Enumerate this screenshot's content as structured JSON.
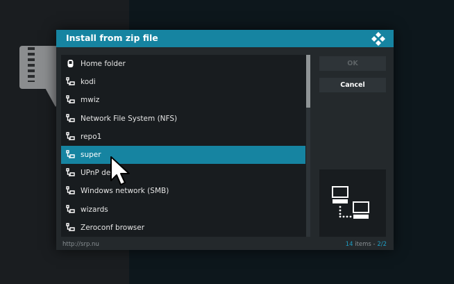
{
  "background": {
    "left_color": "#1a1d20",
    "right_color": "#0d171c"
  },
  "dialog": {
    "title": "Install from zip file",
    "accent_color": "#1684a1",
    "logo_icon": "kodi-logo-icon"
  },
  "list": {
    "items": [
      {
        "label": "Home folder",
        "icon": "home-folder-icon",
        "selected": false
      },
      {
        "label": "kodi",
        "icon": "network-share-icon",
        "selected": false
      },
      {
        "label": "mwiz",
        "icon": "network-share-icon",
        "selected": false
      },
      {
        "label": "Network File System (NFS)",
        "icon": "network-share-icon",
        "selected": false
      },
      {
        "label": "repo1",
        "icon": "network-share-icon",
        "selected": false
      },
      {
        "label": "super",
        "icon": "network-share-icon",
        "selected": true
      },
      {
        "label": "UPnP de",
        "icon": "network-share-icon",
        "selected": false
      },
      {
        "label": "Windows network (SMB)",
        "icon": "network-share-icon",
        "selected": false
      },
      {
        "label": "wizards",
        "icon": "network-share-icon",
        "selected": false
      },
      {
        "label": "Zeroconf browser",
        "icon": "network-share-icon",
        "selected": false
      }
    ]
  },
  "buttons": {
    "ok_label": "OK",
    "cancel_label": "Cancel"
  },
  "preview": {
    "icon": "network-computers-icon"
  },
  "footer": {
    "path": "http://srp.nu",
    "item_count": "14",
    "items_word": " items - ",
    "page": "2/2"
  },
  "cursor": {
    "icon": "mouse-pointer-icon"
  }
}
